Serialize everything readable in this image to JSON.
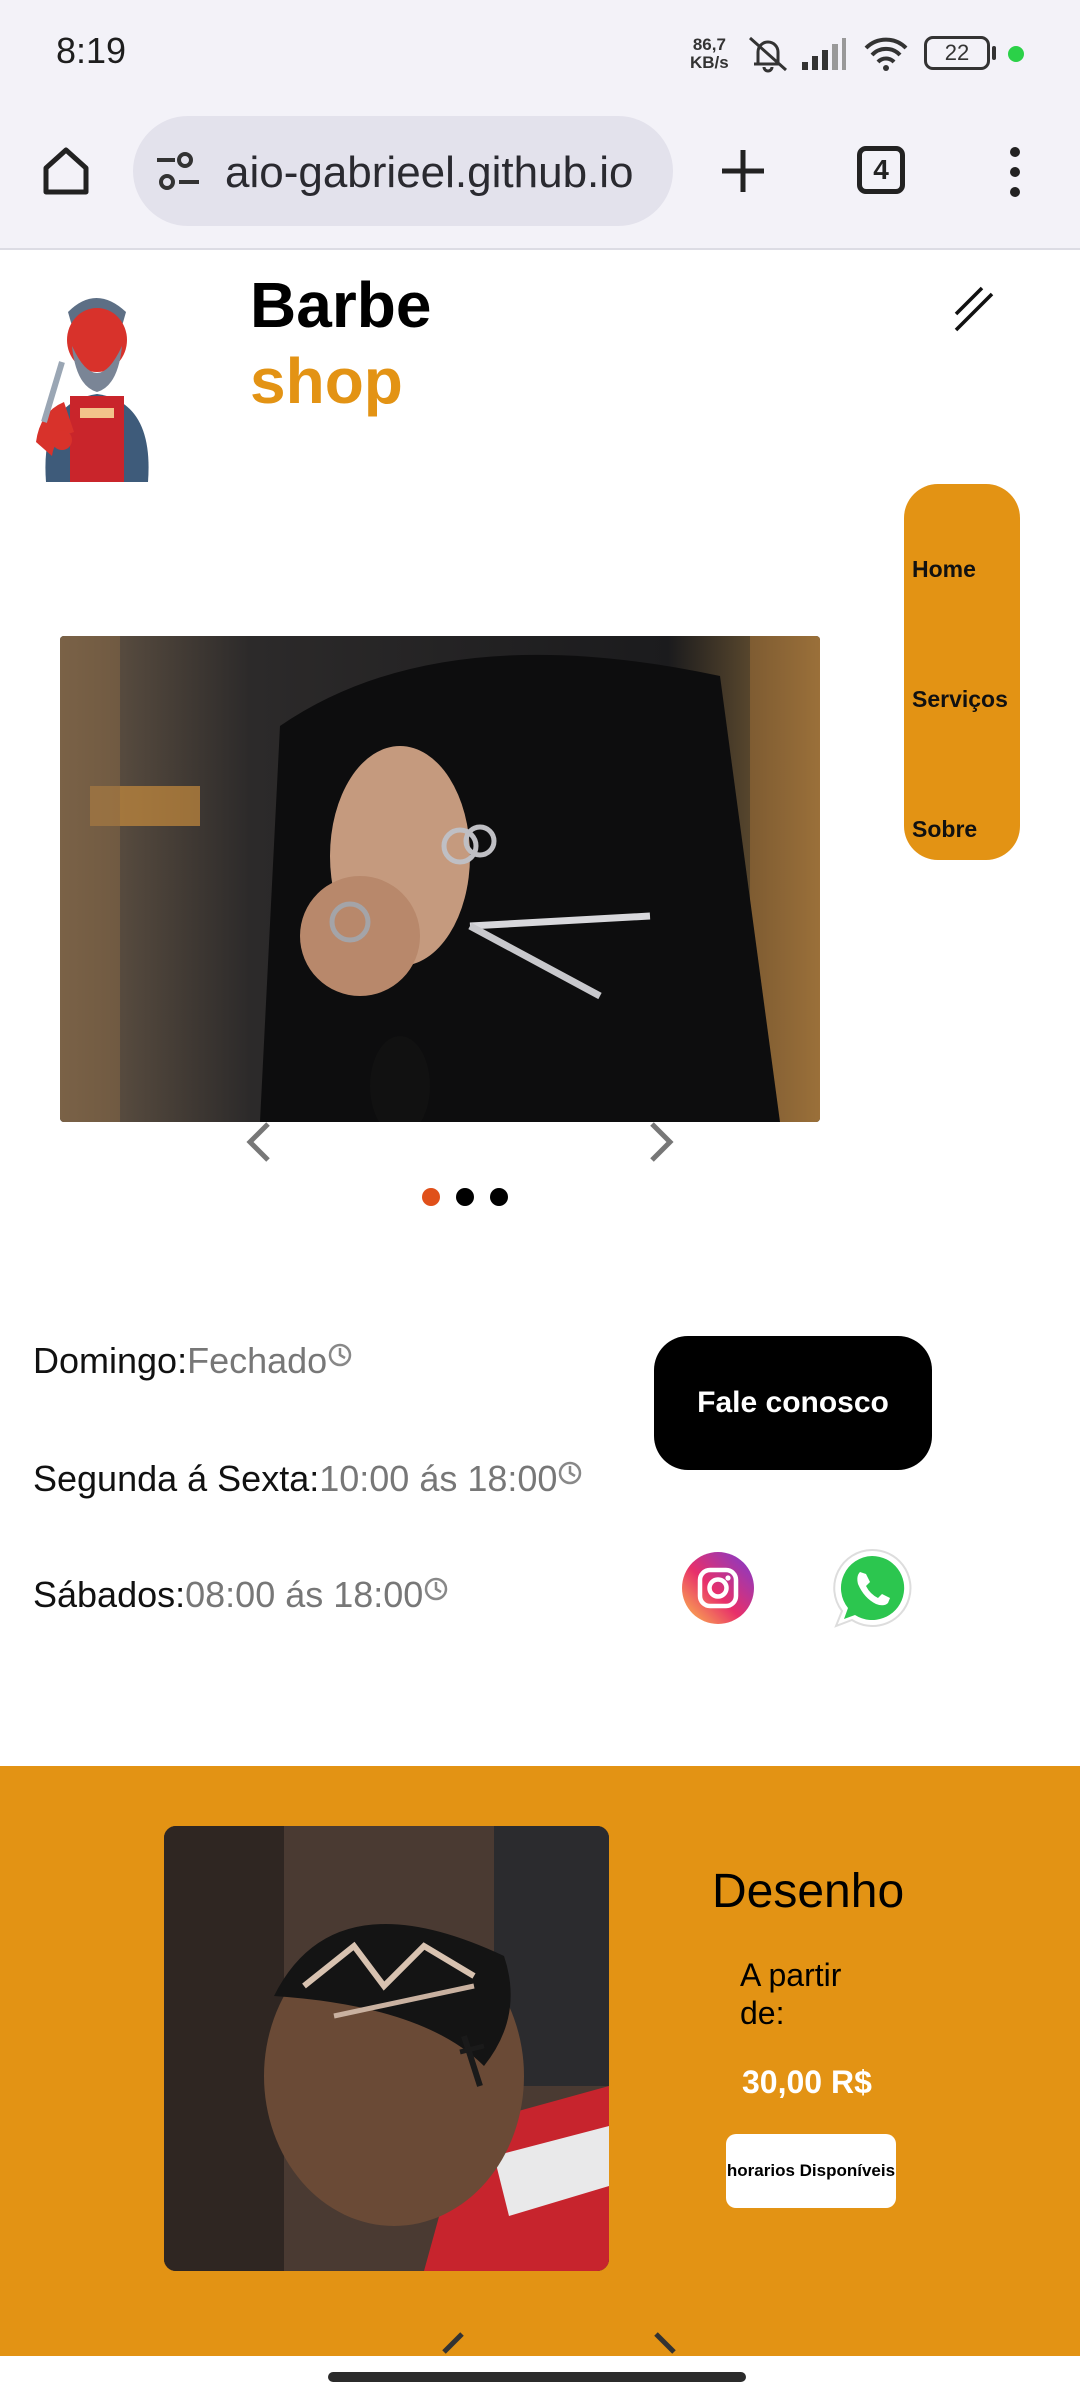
{
  "status_bar": {
    "time": "8:19",
    "net_speed_value": "86,7",
    "net_speed_unit": "KB/s",
    "battery": "22"
  },
  "browser": {
    "url": "aio-gabrieel.github.io",
    "tab_count": "4"
  },
  "header": {
    "brand_line1": "Barbe",
    "brand_line2": "shop"
  },
  "side_menu": {
    "items": [
      "Home",
      "Serviços",
      "Sobre"
    ]
  },
  "carousel": {
    "active_dot": 0,
    "dot_count": 3
  },
  "hours": [
    {
      "label": "Domingo:",
      "value": "Fechado"
    },
    {
      "label": "Segunda á Sexta:",
      "value": "10:00 ás 18:00"
    },
    {
      "label": "Sábados:",
      "value": "08:00 ás 18:00"
    }
  ],
  "contact": {
    "button_label": "Fale conosco"
  },
  "service": {
    "title": "Desenho",
    "from_label": "A partir de:",
    "price": "30,00 R$",
    "button_label": "horarios Disponíveis"
  },
  "colors": {
    "accent": "#e39314",
    "active_dot": "#e0501a",
    "background": "#ffffff"
  }
}
